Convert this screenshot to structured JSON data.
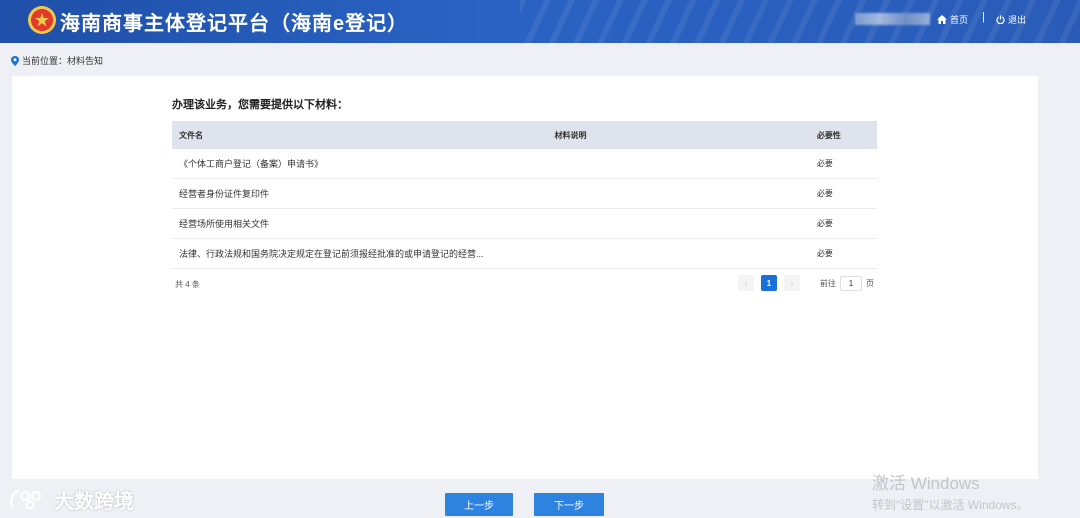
{
  "header": {
    "title": "海南商事主体登记平台（海南e登记）",
    "home_label": "首页",
    "separator": "|",
    "logout_label": "退出"
  },
  "breadcrumb": {
    "text": "当前位置：材料告知"
  },
  "main": {
    "heading": "办理该业务，您需要提供以下材料：",
    "table": {
      "columns": [
        "文件名",
        "材料说明",
        "必要性"
      ],
      "rows": [
        {
          "name": "《个体工商户登记（备案）申请书》",
          "desc": "",
          "necessity": "必要"
        },
        {
          "name": "经营者身份证件复印件",
          "desc": "",
          "necessity": "必要"
        },
        {
          "name": "经营场所使用相关文件",
          "desc": "",
          "necessity": "必要"
        },
        {
          "name": "法律、行政法规和国务院决定规定在登记前须报经批准的或申请登记的经营...",
          "desc": "",
          "necessity": "必要"
        }
      ]
    },
    "pagination": {
      "total_text": "共 4 条",
      "prev": "‹",
      "current_page": "1",
      "next": "›",
      "goto_label": "前往",
      "goto_value": "1",
      "page_unit": "页"
    }
  },
  "footer": {
    "prev_button": "上一步",
    "next_button": "下一步"
  },
  "watermark": {
    "text": "大数跨境"
  },
  "os_overlay": {
    "line1": "激活 Windows",
    "line2": "转到\"设置\"以激活 Windows。"
  },
  "colors": {
    "header_bg": "#2a63c4",
    "primary": "#2f83e0",
    "active_page": "#1b6fd9"
  }
}
